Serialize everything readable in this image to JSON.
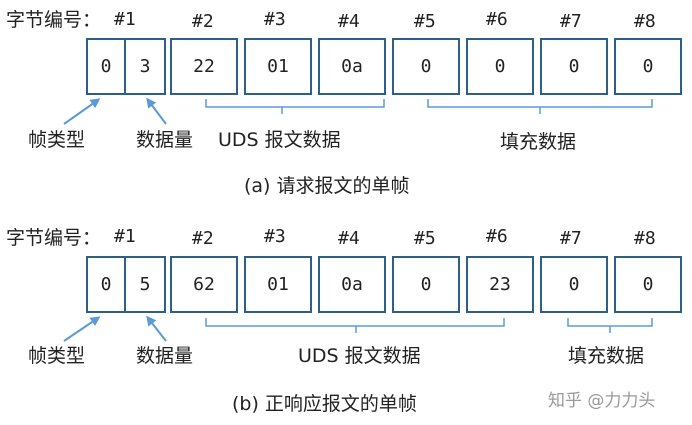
{
  "frame_a": {
    "byte_label": "字节编号：",
    "byte_numbers": [
      "#1",
      "#2",
      "#3",
      "#4",
      "#5",
      "#6",
      "#7",
      "#8"
    ],
    "cells": [
      "0",
      "3",
      "22",
      "01",
      "0a",
      "0",
      "0",
      "0",
      "0"
    ],
    "frame_type_label": "帧类型",
    "data_length_label": "数据量",
    "uds_label": "UDS 报文数据",
    "fill_label": "填充数据",
    "caption": "(a) 请求报文的单帧"
  },
  "frame_b": {
    "byte_label": "字节编号：",
    "byte_numbers": [
      "#1",
      "#2",
      "#3",
      "#4",
      "#5",
      "#6",
      "#7",
      "#8"
    ],
    "cells": [
      "0",
      "5",
      "62",
      "01",
      "0a",
      "0",
      "23",
      "0",
      "0"
    ],
    "frame_type_label": "帧类型",
    "data_length_label": "数据量",
    "uds_label": "UDS 报文数据",
    "fill_label": "填充数据",
    "caption": "(b) 正响应报文的单帧"
  },
  "watermark": "知乎 @力力头",
  "colors": {
    "cell_border": "#2e5f86",
    "arrow": "#5b9bd5",
    "bracket": "#5b9bd5"
  }
}
